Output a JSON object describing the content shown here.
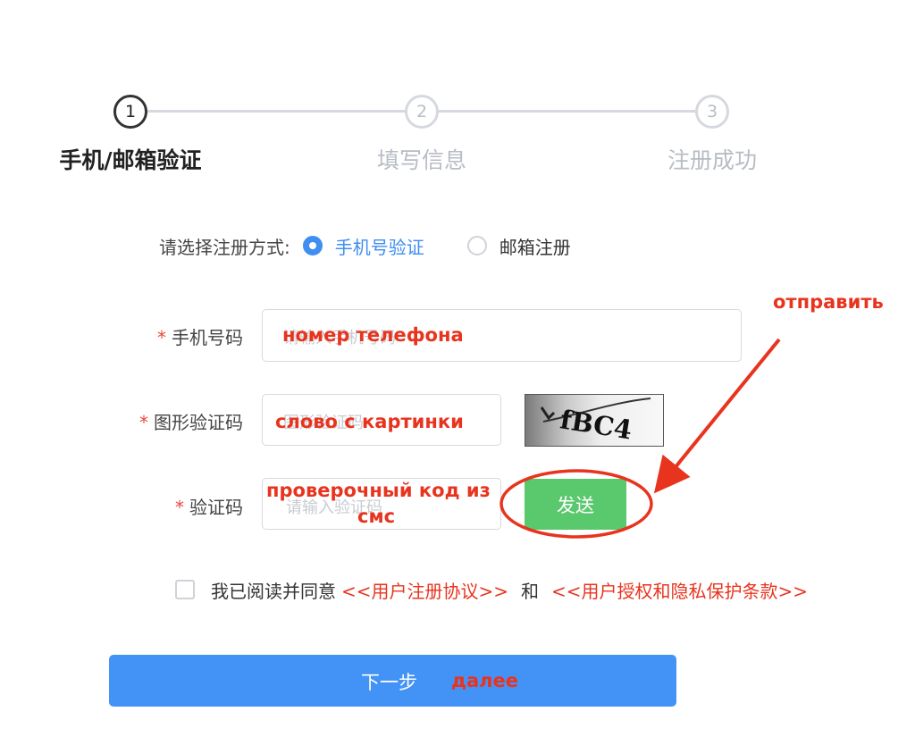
{
  "stepper": {
    "steps": [
      {
        "number": "1",
        "label": "手机/邮箱验证"
      },
      {
        "number": "2",
        "label": "填写信息"
      },
      {
        "number": "3",
        "label": "注册成功"
      }
    ],
    "active_step": 1
  },
  "method": {
    "prompt": "请选择注册方式:",
    "options": [
      {
        "label": "手机号验证",
        "checked": true
      },
      {
        "label": "邮箱注册",
        "checked": false
      }
    ]
  },
  "form": {
    "required_mark": "*",
    "phone": {
      "label": "手机号码",
      "placeholder": "请输入手机号码"
    },
    "captcha": {
      "label": "图形验证码",
      "placeholder": "图形验证码",
      "image_text": "fBC4"
    },
    "sms": {
      "label": "验证码",
      "placeholder": "请输入验证码",
      "send_label": "发送"
    }
  },
  "agreement": {
    "prefix": "我已阅读并同意",
    "link_terms": "<<用户注册协议>>",
    "and": "和",
    "link_privacy": "<<用户授权和隐私保护条款>>"
  },
  "next": {
    "label": "下一步"
  },
  "annotations": {
    "send": "отправить",
    "phone": "номер телефона",
    "captcha": "слово с картинки",
    "sms_line1": "проверочный код из",
    "sms_line2": "смс",
    "next": "далее"
  },
  "colors": {
    "primary_blue": "#4393f7",
    "radio_blue": "#3f8ef0",
    "send_green": "#5ac86c",
    "annotation_red": "#e8341f",
    "step_inactive": "#b8bcc4"
  }
}
